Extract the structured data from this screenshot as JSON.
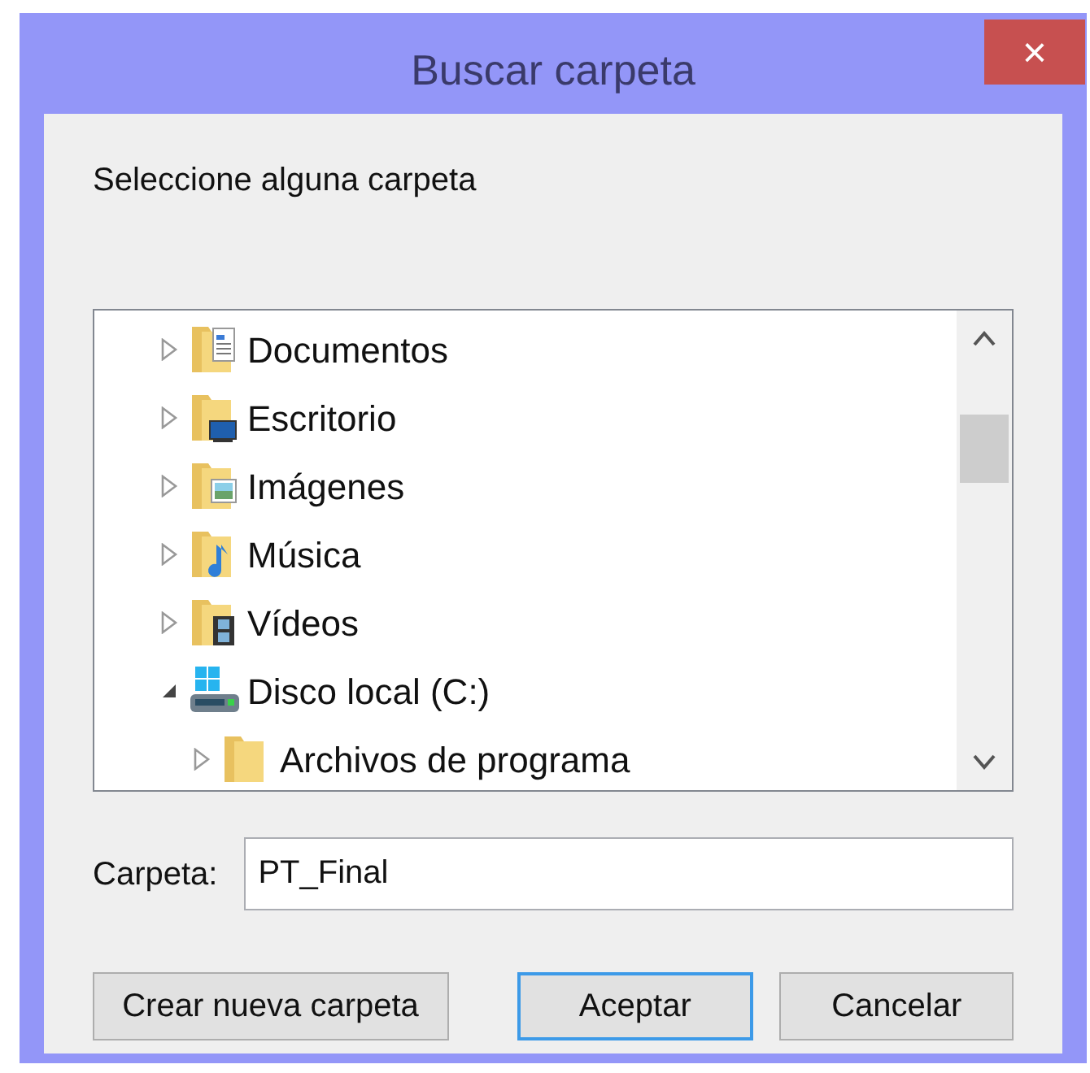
{
  "window": {
    "title": "Buscar carpeta",
    "close": "×"
  },
  "instruction": "Seleccione alguna carpeta",
  "tree": [
    {
      "label": "Documentos",
      "kind": "documents",
      "expanded": false
    },
    {
      "label": "Escritorio",
      "kind": "desktop",
      "expanded": false
    },
    {
      "label": "Imágenes",
      "kind": "pictures",
      "expanded": false
    },
    {
      "label": "Música",
      "kind": "music",
      "expanded": false
    },
    {
      "label": "Vídeos",
      "kind": "videos",
      "expanded": false
    },
    {
      "label": "Disco local (C:)",
      "kind": "drive",
      "expanded": true,
      "children": [
        {
          "label": "Archivos de programa",
          "kind": "folder",
          "expanded": false
        }
      ]
    }
  ],
  "folder_field": {
    "label": "Carpeta:",
    "value": "PT_Final"
  },
  "buttons": [
    {
      "label": "Crear nueva carpeta",
      "default": false
    },
    {
      "label": "Aceptar",
      "default": true
    },
    {
      "label": "Cancelar",
      "default": false
    }
  ]
}
